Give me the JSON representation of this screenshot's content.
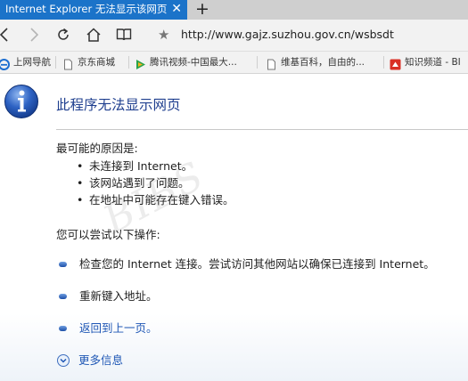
{
  "tab": {
    "title": "Internet Explorer 无法显示该网页",
    "close": "✕"
  },
  "new_tab": "+",
  "address": {
    "url": "http://www.gajz.suzhou.gov.cn/wsbsdt"
  },
  "favorites": [
    {
      "label": "上网导航",
      "icon": "ie-icon",
      "color": "#1e6fd0"
    },
    {
      "label": "京东商城",
      "icon": "page-icon",
      "color": "#888888"
    },
    {
      "label": "腾讯视频-中国最大...",
      "icon": "tencent-video-icon",
      "color": "#2aa34a"
    },
    {
      "label": "维基百科，自由的...",
      "icon": "page-icon",
      "color": "#888888"
    },
    {
      "label": "知识频道 - BI",
      "icon": "zhidao-icon",
      "color": "#d93025"
    }
  ],
  "content": {
    "title": "此程序无法显示网页",
    "reasons_heading": "最可能的原因是:",
    "reasons": [
      "未连接到 Internet。",
      "该网站遇到了问题。",
      "在地址中可能存在键入错误。"
    ],
    "actions_heading": "您可以尝试以下操作:",
    "actions": [
      {
        "text": "检查您的 Internet 连接。尝试访问其他网站以确保已连接到 Internet。",
        "link": false
      },
      {
        "text": "重新键入地址。",
        "link": false
      },
      {
        "text": "返回到上一页。",
        "link": true
      }
    ],
    "more_info": "更多信息"
  },
  "watermark": "BIBS"
}
